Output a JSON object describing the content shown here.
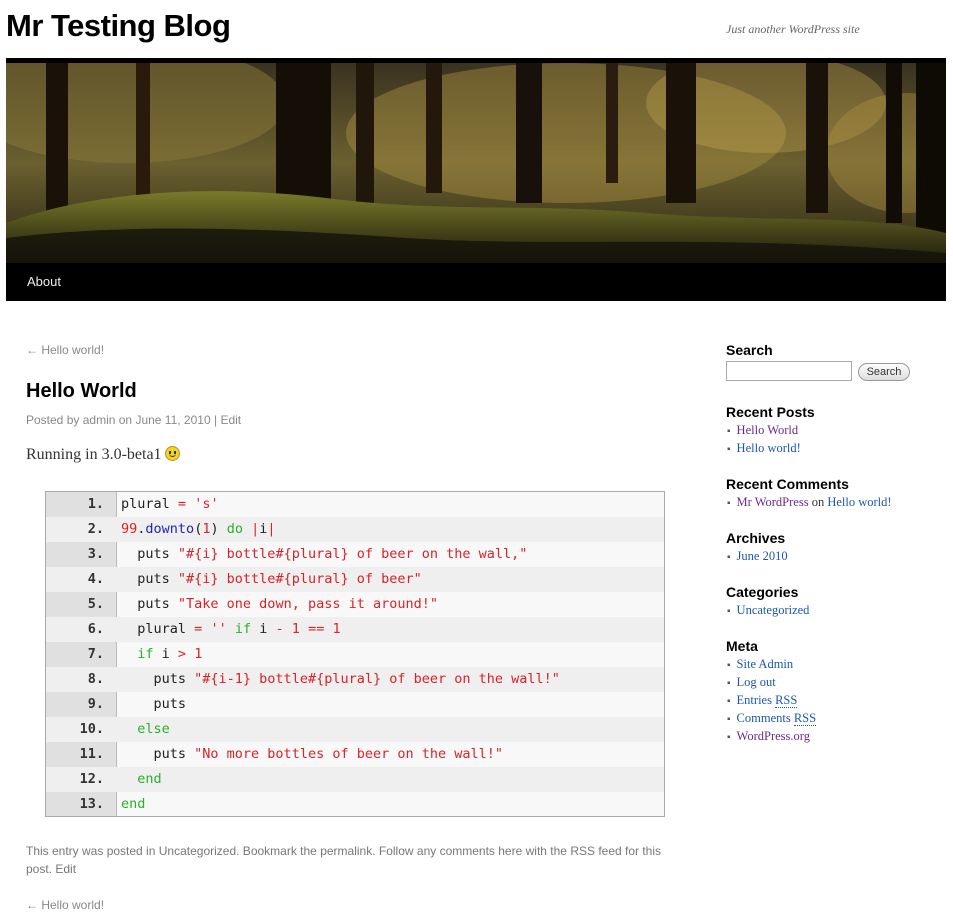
{
  "site": {
    "title": "Mr Testing Blog",
    "description": "Just another WordPress site"
  },
  "nav": {
    "items": [
      "About"
    ]
  },
  "post_nav": {
    "prev": "← Hello world!"
  },
  "post": {
    "title": "Hello World",
    "meta_prefix": "Posted by",
    "author": "admin",
    "meta_on": "on",
    "date": "June 11, 2010",
    "meta_sep": "|",
    "edit": "Edit",
    "body": "Running in 3.0-beta1",
    "emoticon": "smiley-icon"
  },
  "code": {
    "line_numbers": [
      "1.",
      "2.",
      "3.",
      "4.",
      "5.",
      "6.",
      "7.",
      "8.",
      "9.",
      "10.",
      "11.",
      "12.",
      "13."
    ]
  },
  "footer": {
    "t1": "This entry was posted in",
    "category": "Uncategorized",
    "t2": ". Bookmark the",
    "permalink": "permalink",
    "t3": ". Follow any comments here with the",
    "rss": "RSS feed for this post",
    "t4": ".",
    "edit": "Edit",
    "prev": "← Hello world!"
  },
  "sidebar": {
    "search": {
      "title": "Search",
      "button": "Search",
      "value": ""
    },
    "recent_posts": {
      "title": "Recent Posts",
      "items": [
        "Hello World",
        "Hello world!"
      ]
    },
    "recent_comments": {
      "title": "Recent Comments",
      "author": "Mr WordPress",
      "on": "on",
      "post": "Hello world!"
    },
    "archives": {
      "title": "Archives",
      "items": [
        "June 2010"
      ]
    },
    "categories": {
      "title": "Categories",
      "items": [
        "Uncategorized"
      ]
    },
    "meta": {
      "title": "Meta",
      "site_admin": "Site Admin",
      "log_out": "Log out",
      "entries": "Entries",
      "comments": "Comments",
      "rss": "RSS",
      "wordpress": "WordPress.org"
    }
  },
  "colors": {
    "link": "#1b57b1",
    "visited": "#6a2b8f",
    "code_string": "#d9222a",
    "code_keyword": "#2ab02a"
  }
}
